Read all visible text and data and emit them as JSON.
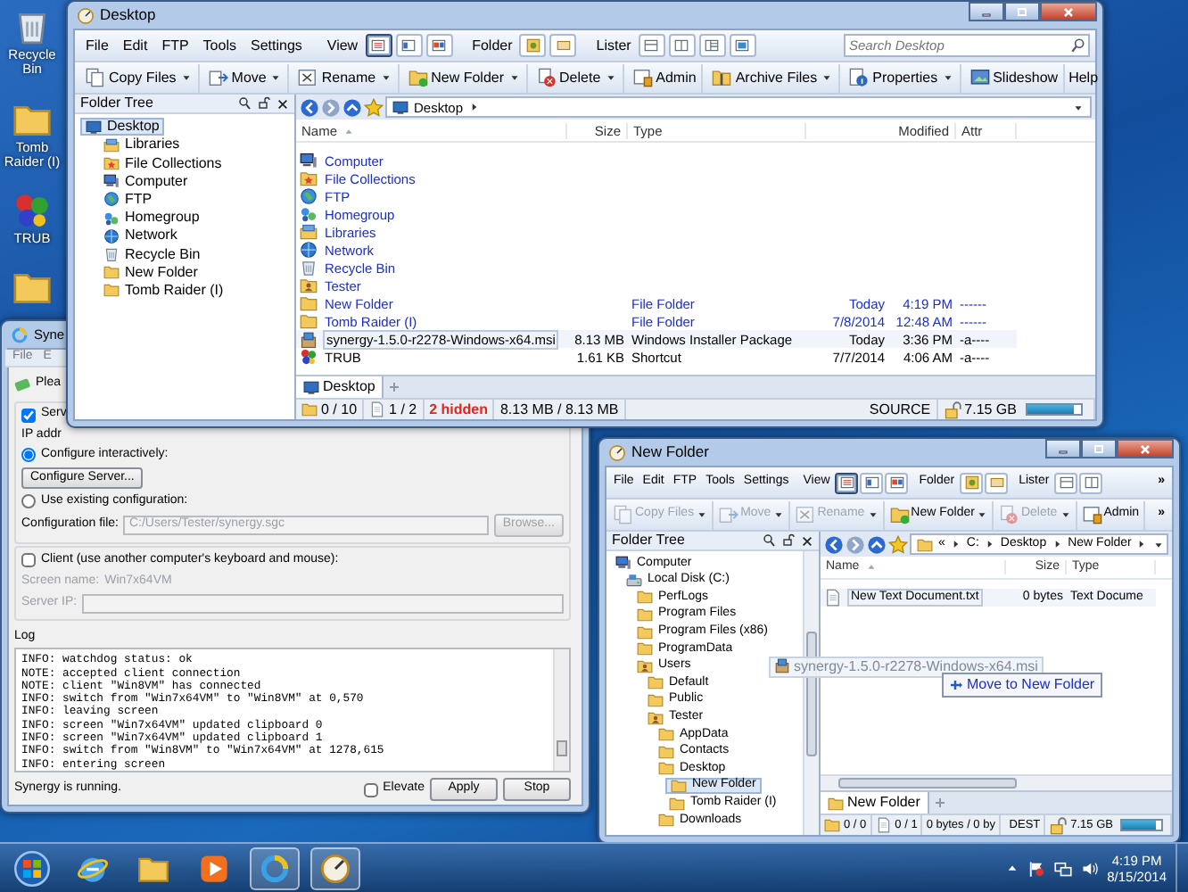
{
  "desktop_icons": [
    {
      "label": "Recycle Bin",
      "kind": "bin"
    },
    {
      "label": "Tomb Raider (I)",
      "kind": "folder"
    },
    {
      "label": "TRUB",
      "kind": "app"
    },
    {
      "kind": "folder"
    }
  ],
  "desktop_window": {
    "title": "Desktop",
    "menu": [
      "File",
      "Edit",
      "FTP",
      "Tools",
      "Settings"
    ],
    "view_label": "View",
    "view_modes": [
      {
        "selected": true
      },
      {
        "selected": false
      },
      {
        "selected": false
      }
    ],
    "folder_label": "Folder",
    "folder_modes": [
      {
        "selected": false
      },
      {
        "selected": false
      }
    ],
    "lister_label": "Lister",
    "lister_modes": [
      {
        "selected": false
      },
      {
        "selected": false
      },
      {
        "selected": false
      },
      {
        "selected": false
      }
    ],
    "search": {
      "placeholder": "Search Desktop"
    },
    "toolbar": [
      {
        "label": "Copy Files",
        "kind": "copy",
        "dropdown": true,
        "disabled": false
      },
      {
        "label": "Move",
        "kind": "move",
        "dropdown": true,
        "disabled": false
      },
      {
        "label": "Rename",
        "kind": "rename",
        "dropdown": true,
        "disabled": false
      },
      {
        "label": "New Folder",
        "kind": "newfolder",
        "dropdown": true,
        "disabled": false
      },
      {
        "label": "Delete",
        "kind": "delete",
        "dropdown": true,
        "disabled": false
      },
      {
        "label": "Admin",
        "kind": "admin",
        "dropdown": false,
        "disabled": false
      },
      {
        "label": "Archive Files",
        "kind": "archive",
        "dropdown": true,
        "disabled": false
      },
      {
        "label": "Properties",
        "kind": "properties",
        "dropdown": true,
        "disabled": false
      },
      {
        "label": "Slideshow",
        "kind": "slideshow",
        "dropdown": false,
        "disabled": false
      }
    ],
    "help": "Help",
    "tree_title": "Folder Tree",
    "tree": [
      {
        "label": "Desktop",
        "kind": "desktop",
        "selected": true,
        "children": [
          {
            "label": "Libraries",
            "kind": "library",
            "selected": false
          },
          {
            "label": "File Collections",
            "kind": "collection",
            "selected": false
          },
          {
            "label": "Computer",
            "kind": "computer",
            "selected": false
          },
          {
            "label": "FTP",
            "kind": "globe",
            "selected": false
          },
          {
            "label": "Homegroup",
            "kind": "homegroup",
            "selected": false
          },
          {
            "label": "Network",
            "kind": "network",
            "selected": false
          },
          {
            "label": "Recycle Bin",
            "kind": "bin",
            "selected": false
          },
          {
            "label": "New Folder",
            "kind": "folder",
            "selected": false
          },
          {
            "label": "Tomb Raider (I)",
            "kind": "folder",
            "selected": false
          }
        ]
      }
    ],
    "path": [
      "Desktop"
    ],
    "columns": [
      "Name",
      "Size",
      "Type",
      "Modified",
      "Attr"
    ],
    "rows": [
      {
        "name": "Computer",
        "kind": "computer",
        "selected": false
      },
      {
        "name": "File Collections",
        "kind": "collection",
        "selected": false
      },
      {
        "name": "FTP",
        "kind": "globe",
        "selected": false
      },
      {
        "name": "Homegroup",
        "kind": "homegroup",
        "selected": false
      },
      {
        "name": "Libraries",
        "kind": "library",
        "selected": false
      },
      {
        "name": "Network",
        "kind": "network",
        "selected": false
      },
      {
        "name": "Recycle Bin",
        "kind": "bin",
        "selected": false
      },
      {
        "name": "Tester",
        "kind": "user",
        "selected": false
      },
      {
        "name": "New Folder",
        "kind": "folder",
        "type": "File Folder",
        "date": "Today",
        "time": "4:19 PM",
        "attr": "------",
        "selected": false
      },
      {
        "name": "Tomb Raider (I)",
        "kind": "folder",
        "type": "File Folder",
        "date": "7/8/2014",
        "time": "12:48 AM",
        "attr": "------",
        "selected": false
      },
      {
        "name": "synergy-1.5.0-r2278-Windows-x64.msi",
        "kind": "package",
        "size": "8.13 MB",
        "type": "Windows Installer Package",
        "date": "Today",
        "time": "3:36 PM",
        "attr": "-a----",
        "selected": true
      },
      {
        "name": "TRUB",
        "kind": "app",
        "size": "1.61 KB",
        "type": "Shortcut",
        "date": "7/7/2014",
        "time": "4:06 AM",
        "attr": "-a----",
        "selected": false
      }
    ],
    "tabs": [
      {
        "label": "Desktop",
        "kind": "desktop",
        "selected": true
      }
    ],
    "status": [
      {
        "kind": "folder",
        "text": "0 / 10"
      },
      {
        "kind": "file",
        "text": "1 / 2"
      },
      {
        "kind": "hidden",
        "text": "2 hidden"
      },
      {
        "kind": "size",
        "text": "8.13 MB / 8.13 MB"
      }
    ],
    "pane_role": "SOURCE",
    "free_space": {
      "text": "7.15 GB",
      "level": 0.85
    }
  },
  "synergy_window": {
    "title": "Syne",
    "menu": [
      "File",
      "E"
    ],
    "message": "Plea",
    "server": {
      "label": "Serv",
      "checked": true
    },
    "ip_label": "IP addr",
    "modes": [
      {
        "label": "Configure interactively:",
        "selected": true
      },
      {
        "label": "Use existing configuration:",
        "selected": false
      }
    ],
    "configure_button": "Configure Server...",
    "config_file": {
      "label": "Configuration file:",
      "value": "C:/Users/Tester/synergy.sgc",
      "disabled": true
    },
    "browse_button": {
      "label": "Browse...",
      "disabled": true
    },
    "client": {
      "label": "Client (use another computer's keyboard and mouse):",
      "checked": false
    },
    "screen_name": {
      "label": "Screen name:",
      "value": "Win7x64VM",
      "disabled": true
    },
    "server_ip": {
      "label": "Server IP:",
      "disabled": true
    },
    "log_title": "Log",
    "log": [
      "INFO: watchdog status: ok",
      "NOTE: accepted client connection",
      "NOTE: client \"Win8VM\" has connected",
      "INFO: switch from \"Win7x64VM\" to \"Win8VM\" at 0,570",
      "INFO: leaving screen",
      "INFO: screen \"Win7x64VM\" updated clipboard 0",
      "INFO: screen \"Win7x64VM\" updated clipboard 1",
      "INFO: switch from \"Win8VM\" to \"Win7x64VM\" at 1278,615",
      "INFO: entering screen"
    ],
    "status": "Synergy is running.",
    "elevate": {
      "label": "Elevate",
      "checked": false
    },
    "buttons": [
      "Apply",
      "Stop"
    ]
  },
  "new_folder_window": {
    "title": "New Folder",
    "menu": [
      "File",
      "Edit",
      "FTP",
      "Tools",
      "Settings"
    ],
    "view_label": "View",
    "view_modes": [
      {
        "selected": true
      },
      {
        "selected": false
      },
      {
        "selected": false
      }
    ],
    "folder_label": "Folder",
    "folder_modes": [
      {
        "selected": false
      },
      {
        "selected": false
      }
    ],
    "lister_label": "Lister",
    "lister_modes": [
      {
        "selected": false
      },
      {
        "selected": false
      }
    ],
    "menu_overflow": "»",
    "toolbar": [
      {
        "label": "Copy Files",
        "kind": "copy",
        "dropdown": true,
        "disabled": true
      },
      {
        "label": "Move",
        "kind": "move",
        "dropdown": true,
        "disabled": true
      },
      {
        "label": "Rename",
        "kind": "rename",
        "dropdown": true,
        "disabled": true
      },
      {
        "label": "New Folder",
        "kind": "newfolder",
        "dropdown": true,
        "disabled": false
      },
      {
        "label": "Delete",
        "kind": "delete",
        "dropdown": true,
        "disabled": true
      },
      {
        "label": "Admin",
        "kind": "admin",
        "dropdown": false,
        "disabled": false
      }
    ],
    "toolbar_overflow": "»",
    "tree_title": "Folder Tree",
    "tree": [
      {
        "label": "Computer",
        "kind": "computer",
        "selected": false,
        "children": [
          {
            "label": "Local Disk (C:)",
            "kind": "drive",
            "selected": false,
            "children": [
              {
                "label": "PerfLogs",
                "kind": "folder",
                "selected": false
              },
              {
                "label": "Program Files",
                "kind": "folder",
                "selected": false
              },
              {
                "label": "Program Files (x86)",
                "kind": "folder",
                "selected": false
              },
              {
                "label": "ProgramData",
                "kind": "folder",
                "selected": false
              },
              {
                "label": "Users",
                "kind": "user",
                "selected": false,
                "children": [
                  {
                    "label": "Default",
                    "kind": "folder",
                    "selected": false
                  },
                  {
                    "label": "Public",
                    "kind": "folder",
                    "selected": false
                  },
                  {
                    "label": "Tester",
                    "kind": "user",
                    "selected": false,
                    "children": [
                      {
                        "label": "AppData",
                        "kind": "folder",
                        "selected": false
                      },
                      {
                        "label": "Contacts",
                        "kind": "folder",
                        "selected": false
                      },
                      {
                        "label": "Desktop",
                        "kind": "folder",
                        "selected": false,
                        "children": [
                          {
                            "label": "New Folder",
                            "kind": "folder",
                            "selected": true
                          },
                          {
                            "label": "Tomb Raider (I)",
                            "kind": "folder",
                            "selected": false
                          }
                        ]
                      },
                      {
                        "label": "Downloads",
                        "kind": "folder",
                        "selected": false
                      }
                    ]
                  }
                ]
              }
            ]
          }
        ]
      }
    ],
    "path_overflow": "«",
    "path": [
      "C:",
      "Desktop",
      "New Folder"
    ],
    "columns": [
      "Name",
      "Size",
      "Type"
    ],
    "rows": [
      {
        "name": "New Text Document.txt",
        "kind": "file",
        "size": "0 bytes",
        "type": "Text Docume",
        "selected": true
      }
    ],
    "drag": {
      "ghost": "synergy-1.5.0-r2278-Windows-x64.msi",
      "tooltip": "Move to New Folder"
    },
    "tabs": [
      {
        "label": "New Folder",
        "kind": "folder",
        "selected": true
      }
    ],
    "status": [
      {
        "kind": "folder",
        "text": "0 / 0"
      },
      {
        "kind": "file",
        "text": "0 / 1"
      },
      {
        "kind": "size",
        "text": "0 bytes / 0 by"
      }
    ],
    "pane_role": "DEST",
    "free_space": {
      "text": "7.15 GB",
      "level": 0.85
    }
  },
  "taskbar": {
    "items": [
      {
        "kind": "browser",
        "active": false
      },
      {
        "kind": "folder",
        "active": false
      },
      {
        "kind": "media",
        "active": false
      },
      {
        "kind": "ring",
        "active": true
      },
      {
        "kind": "gauge",
        "active": true
      }
    ],
    "time": "4:19 PM",
    "date": "8/15/2014"
  }
}
